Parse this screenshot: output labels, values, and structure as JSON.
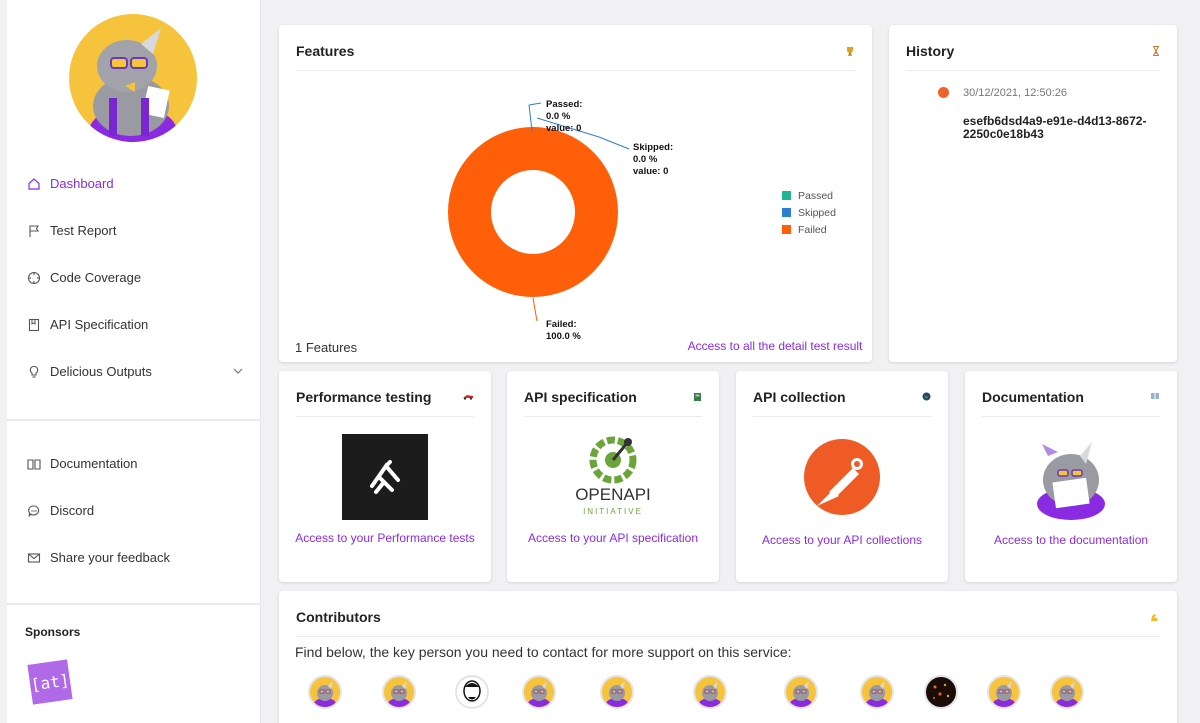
{
  "sidebar": {
    "nav": [
      {
        "label": "Dashboard",
        "icon": "home-icon"
      },
      {
        "label": "Test Report",
        "icon": "flag-icon"
      },
      {
        "label": "Code Coverage",
        "icon": "crosshair-icon"
      },
      {
        "label": "API Specification",
        "icon": "book-icon"
      },
      {
        "label": "Delicious Outputs",
        "icon": "lightbulb-icon"
      }
    ],
    "nav2": [
      {
        "label": "Documentation",
        "icon": "open-book-icon"
      },
      {
        "label": "Discord",
        "icon": "chat-bubble-icon"
      },
      {
        "label": "Share your feedback",
        "icon": "mail-icon"
      }
    ],
    "sponsors_title": "Sponsors",
    "sponsor_logo_text": "[at]"
  },
  "features": {
    "title": "Features",
    "count_label": "1 Features",
    "link": "Access to all the detail test result",
    "chart_data": {
      "type": "pie",
      "categories": [
        "Passed",
        "Skipped",
        "Failed"
      ],
      "values": [
        0,
        0,
        100
      ],
      "percent_labels": [
        "0.0 %",
        "0.0 %",
        "100.0 %"
      ],
      "value_labels": [
        "value: 0",
        "value: 0"
      ],
      "colors": [
        "#1fb493",
        "#2b7fd0",
        "#fe5f08"
      ],
      "legend_position": "right"
    },
    "callouts": {
      "passed_name": "Passed:",
      "skipped_name": "Skipped:",
      "failed_name": "Failed:"
    }
  },
  "history": {
    "title": "History",
    "time": "30/12/2021, 12:50:26",
    "id": "esefb6dsd4a9-e91e-d4d13-8672-2250c0e18b43",
    "dot_color": "#f0622a"
  },
  "cards": {
    "performance": {
      "title": "Performance testing",
      "link": "Access to your Performance tests"
    },
    "api_spec": {
      "title": "API specification",
      "link": "Access to your API specification",
      "logo_text": "OPENAPI",
      "logo_sub": "INITIATIVE"
    },
    "api_collection": {
      "title": "API collection",
      "link": "Access to your API collections"
    },
    "documentation": {
      "title": "Documentation",
      "link": "Access to the documentation"
    }
  },
  "contributors": {
    "title": "Contributors",
    "text": "Find below, the key person you need to contact for more support on this service:"
  },
  "accent": "#8a2be2"
}
